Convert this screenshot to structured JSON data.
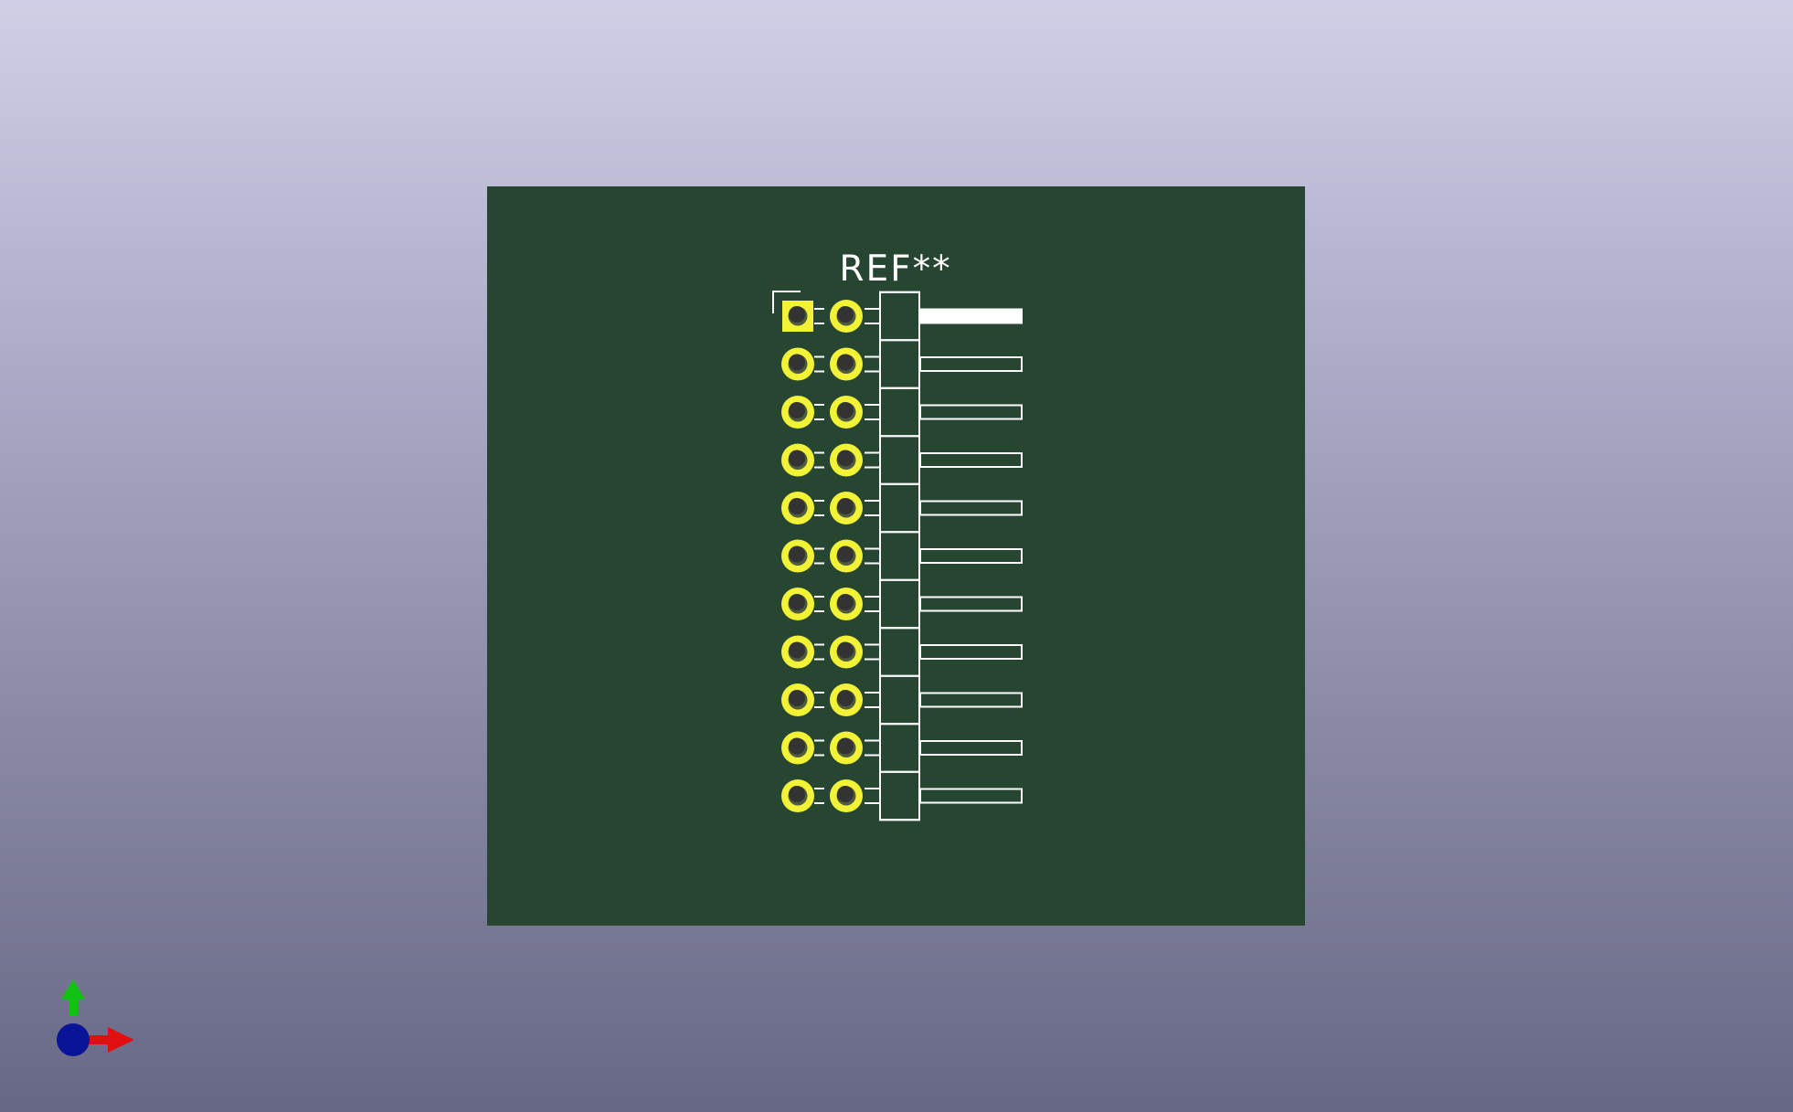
{
  "board": {
    "reference_label": "REF**",
    "pin_rows": 11,
    "pin_columns": 2,
    "colors": {
      "background_top": "#cfcfe6",
      "background_bottom": "#676885",
      "board": "#264632",
      "pad": "#f2f237",
      "silkscreen": "#ffffff",
      "drill": "#333333"
    }
  },
  "axes_gizmo": {
    "x_axis_color": "#e01010",
    "y_axis_color": "#12c212",
    "z_axis_color": "#0a1496",
    "icon": "xyz-axes-icon"
  }
}
